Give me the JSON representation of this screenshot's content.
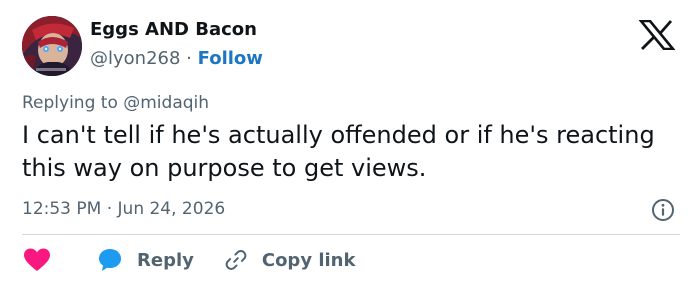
{
  "tweet": {
    "author": {
      "display_name": "Eggs AND Bacon",
      "handle": "@lyon268",
      "separator": "·",
      "follow_label": "Follow"
    },
    "replying_to": {
      "prefix": "Replying to",
      "mention": "@midaqih"
    },
    "text": "I can't tell if he's actually offended or if he's reacting this way on purpose to get views.",
    "timestamp": "12:53 PM · Jun 24, 2026",
    "actions": {
      "reply_label": "Reply",
      "copy_link_label": "Copy link"
    }
  },
  "icons": {
    "brand": "x-logo-icon",
    "info": "info-icon",
    "like": "heart-icon",
    "reply": "chat-bubble-icon",
    "copy_link": "link-icon"
  },
  "colors": {
    "text_primary": "#0f1419",
    "text_secondary": "#536471",
    "link_blue": "#1d76c2",
    "like_pink": "#f91880",
    "reply_blue": "#1d9bf0",
    "divider": "#cfd9de"
  }
}
